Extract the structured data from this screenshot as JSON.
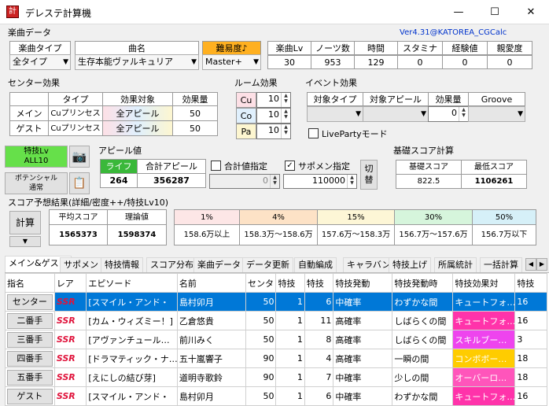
{
  "window": {
    "title": "デレステ計算機",
    "min": "—",
    "max": "☐",
    "close": "✕"
  },
  "version": "Ver4.31@KATOREA_CGCalc",
  "song": {
    "section": "楽曲データ",
    "type_label": "楽曲タイプ",
    "type_value": "全タイプ",
    "name_label": "曲名",
    "name_value": "生存本能ヴァルキュリア",
    "difficulty_label": "難易度♪",
    "difficulty_value": "Master+",
    "lv_label": "楽曲Lv",
    "lv": "30",
    "notes_label": "ノーツ数",
    "notes": "953",
    "time_label": "時間",
    "time": "129",
    "stamina_label": "スタミナ",
    "stamina": "0",
    "exp_label": "経験値",
    "exp": "0",
    "aff_label": "親愛度",
    "aff": "0"
  },
  "center": {
    "section": "センター効果",
    "h_type": "タイプ",
    "h_target": "効果対象",
    "h_amount": "効果量",
    "main_label": "メイン",
    "main_type": "Cuプリンセス",
    "main_target": "全アピール",
    "main_amount": "50",
    "guest_label": "ゲスト",
    "guest_type": "Cuプリンセス",
    "guest_target": "全アピール",
    "guest_amount": "50"
  },
  "room": {
    "section": "ルーム効果",
    "cu": "Cu",
    "cu_val": "10",
    "co": "Co",
    "co_val": "10",
    "pa": "Pa",
    "pa_val": "10"
  },
  "event": {
    "section": "イベント効果",
    "h_type": "対象タイプ",
    "h_appeal": "対象アピール",
    "h_amount": "効果量",
    "h_groove": "Groove",
    "amount": "0",
    "liveparty": "LivePartyモード"
  },
  "skill": {
    "btn_label": "特技Lv\nALL10",
    "potential_label": "ポテンシャル\n通常",
    "camera": "📷",
    "copy": "📋"
  },
  "appeal": {
    "section": "アピール値",
    "life_label": "ライフ",
    "total_label": "合計アピール",
    "life": "264",
    "total": "356287",
    "total_spec_label": "合計値指定",
    "total_spec_val": "0",
    "support_label": "サポメン指定",
    "support_val": "110000",
    "switch": "切替"
  },
  "base": {
    "section": "基礎スコア計算",
    "h_base": "基礎スコア",
    "h_min": "最低スコア",
    "base": "822.5",
    "min": "1106261"
  },
  "predict": {
    "section": "スコア予想結果(詳細/密度++/特技Lv10)",
    "calc": "計算",
    "avg_label": "平均スコア",
    "theory_label": "理論値",
    "avg": "1565373",
    "theory": "1598374",
    "pct": [
      "1%",
      "4%",
      "15%",
      "30%",
      "50%"
    ],
    "vals": [
      "158.6万以上",
      "158.3万〜158.6万",
      "157.6万〜158.3万",
      "156.7万〜157.6万",
      "156.7万以下"
    ],
    "pct_colors": [
      "#fde6e6",
      "#fde2c6",
      "#fdf6d6",
      "#d6f5dc",
      "#d6f0f8"
    ]
  },
  "tabs": [
    "メイン&ゲスト",
    "サポメン",
    "特技情報",
    "スコア分布",
    "楽曲データ",
    "データ更新",
    "自動編成",
    "キャラバン",
    "特技上げ",
    "所属統計",
    "一括計算"
  ],
  "grid": {
    "headers": [
      "指名",
      "レア",
      "エピソード",
      "名前",
      "センタ",
      "特技",
      "特技",
      "特技発動",
      "特技発動時",
      "特技効果対",
      "特技"
    ],
    "rows": [
      {
        "pos": "センター",
        "rare": "SSR",
        "ep": "[スマイル・アンド・",
        "name": "島村卯月",
        "c": "50",
        "s1": "1",
        "s2": "6",
        "prob": "中確率",
        "when": "わずかな間",
        "eff": "キュートフォ…",
        "eff_bg": "#3b8ede",
        "n": "16",
        "selected": true
      },
      {
        "pos": "二番手",
        "rare": "SSR",
        "ep": "[カム・ウィズミー！]",
        "name": "乙倉悠貴",
        "c": "50",
        "s1": "1",
        "s2": "11",
        "prob": "高確率",
        "when": "しばらくの間",
        "eff": "キュートフォ…",
        "eff_bg": "#ff33aa",
        "n": "16",
        "selected": false
      },
      {
        "pos": "三番手",
        "rare": "SSR",
        "ep": "[アヴァンチュール…",
        "name": "前川みく",
        "c": "50",
        "s1": "1",
        "s2": "8",
        "prob": "高確率",
        "when": "しばらくの間",
        "eff": "スキルブー…",
        "eff_bg": "#ee44ee",
        "n": "3",
        "selected": false
      },
      {
        "pos": "四番手",
        "rare": "SSR",
        "ep": "[ドラマティック・ナ…",
        "name": "五十嵐響子",
        "c": "90",
        "s1": "1",
        "s2": "4",
        "prob": "高確率",
        "when": "一瞬の間",
        "eff": "コンボボー…",
        "eff_bg": "#ffcc00",
        "n": "18",
        "selected": false
      },
      {
        "pos": "五番手",
        "rare": "SSR",
        "ep": "[えにしの結び芽]",
        "name": "道明寺歌鈴",
        "c": "90",
        "s1": "1",
        "s2": "7",
        "prob": "中確率",
        "when": "少しの間",
        "eff": "オーバーロ…",
        "eff_bg": "#ff55bb",
        "n": "18",
        "selected": false
      },
      {
        "pos": "ゲスト",
        "rare": "SSR",
        "ep": "[スマイル・アンド・",
        "name": "島村卯月",
        "c": "50",
        "s1": "1",
        "s2": "6",
        "prob": "中確率",
        "when": "わずかな間",
        "eff": "キュートフォ…",
        "eff_bg": "#ff33aa",
        "n": "16",
        "selected": false
      }
    ]
  }
}
